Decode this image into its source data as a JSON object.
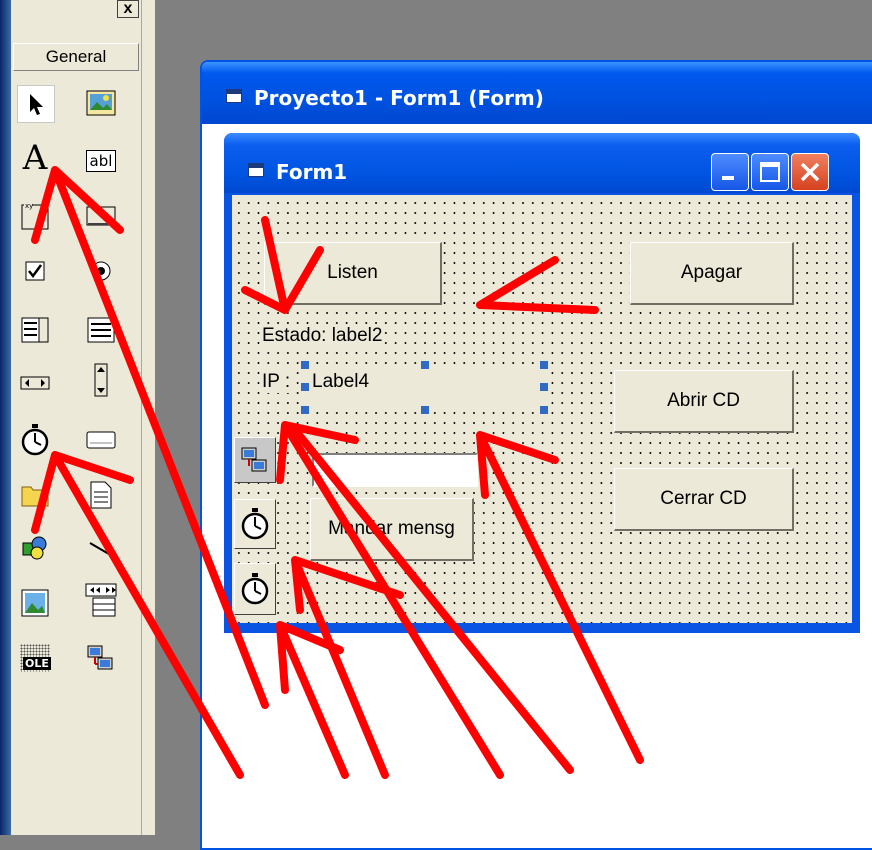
{
  "toolbox": {
    "title_close": "x",
    "general_tab": "General",
    "tools": [
      {
        "icon": "pointer-icon"
      },
      {
        "icon": "picturebox-icon"
      },
      {
        "icon": "label-icon",
        "glyph": "A"
      },
      {
        "icon": "textbox-icon",
        "glyph": "abl"
      },
      {
        "icon": "frame-icon"
      },
      {
        "icon": "commandbutton-icon"
      },
      {
        "icon": "checkbox-icon"
      },
      {
        "icon": "optionbutton-icon"
      },
      {
        "icon": "combobox-icon"
      },
      {
        "icon": "listbox-icon"
      },
      {
        "icon": "hscrollbar-icon"
      },
      {
        "icon": "vscrollbar-icon"
      },
      {
        "icon": "timer-icon"
      },
      {
        "icon": "drivelistbox-icon"
      },
      {
        "icon": "dirlistbox-icon"
      },
      {
        "icon": "filelistbox-icon"
      },
      {
        "icon": "shape-icon"
      },
      {
        "icon": "line-icon"
      },
      {
        "icon": "image-icon"
      },
      {
        "icon": "data-icon"
      },
      {
        "icon": "ole-icon",
        "glyph": "OLE"
      },
      {
        "icon": "winsock-icon"
      }
    ]
  },
  "designer": {
    "title": "Proyecto1 - Form1 (Form)"
  },
  "form1": {
    "title": "Form1",
    "buttons": {
      "listen": "Listen",
      "apagar": "Apagar",
      "abrir_cd": "Abrir CD",
      "cerrar_cd": "Cerrar CD",
      "mandar": "Mandar mensg"
    },
    "labels": {
      "estado": "Estado: label2",
      "ip_prefix": "IP :",
      "ip_value": "Label4"
    },
    "text_value": ""
  },
  "colors": {
    "title_blue": "#0054e3",
    "form_background": "#ece9d8",
    "annotation_red": "#ff0000",
    "selection_handle": "#316ac5"
  }
}
